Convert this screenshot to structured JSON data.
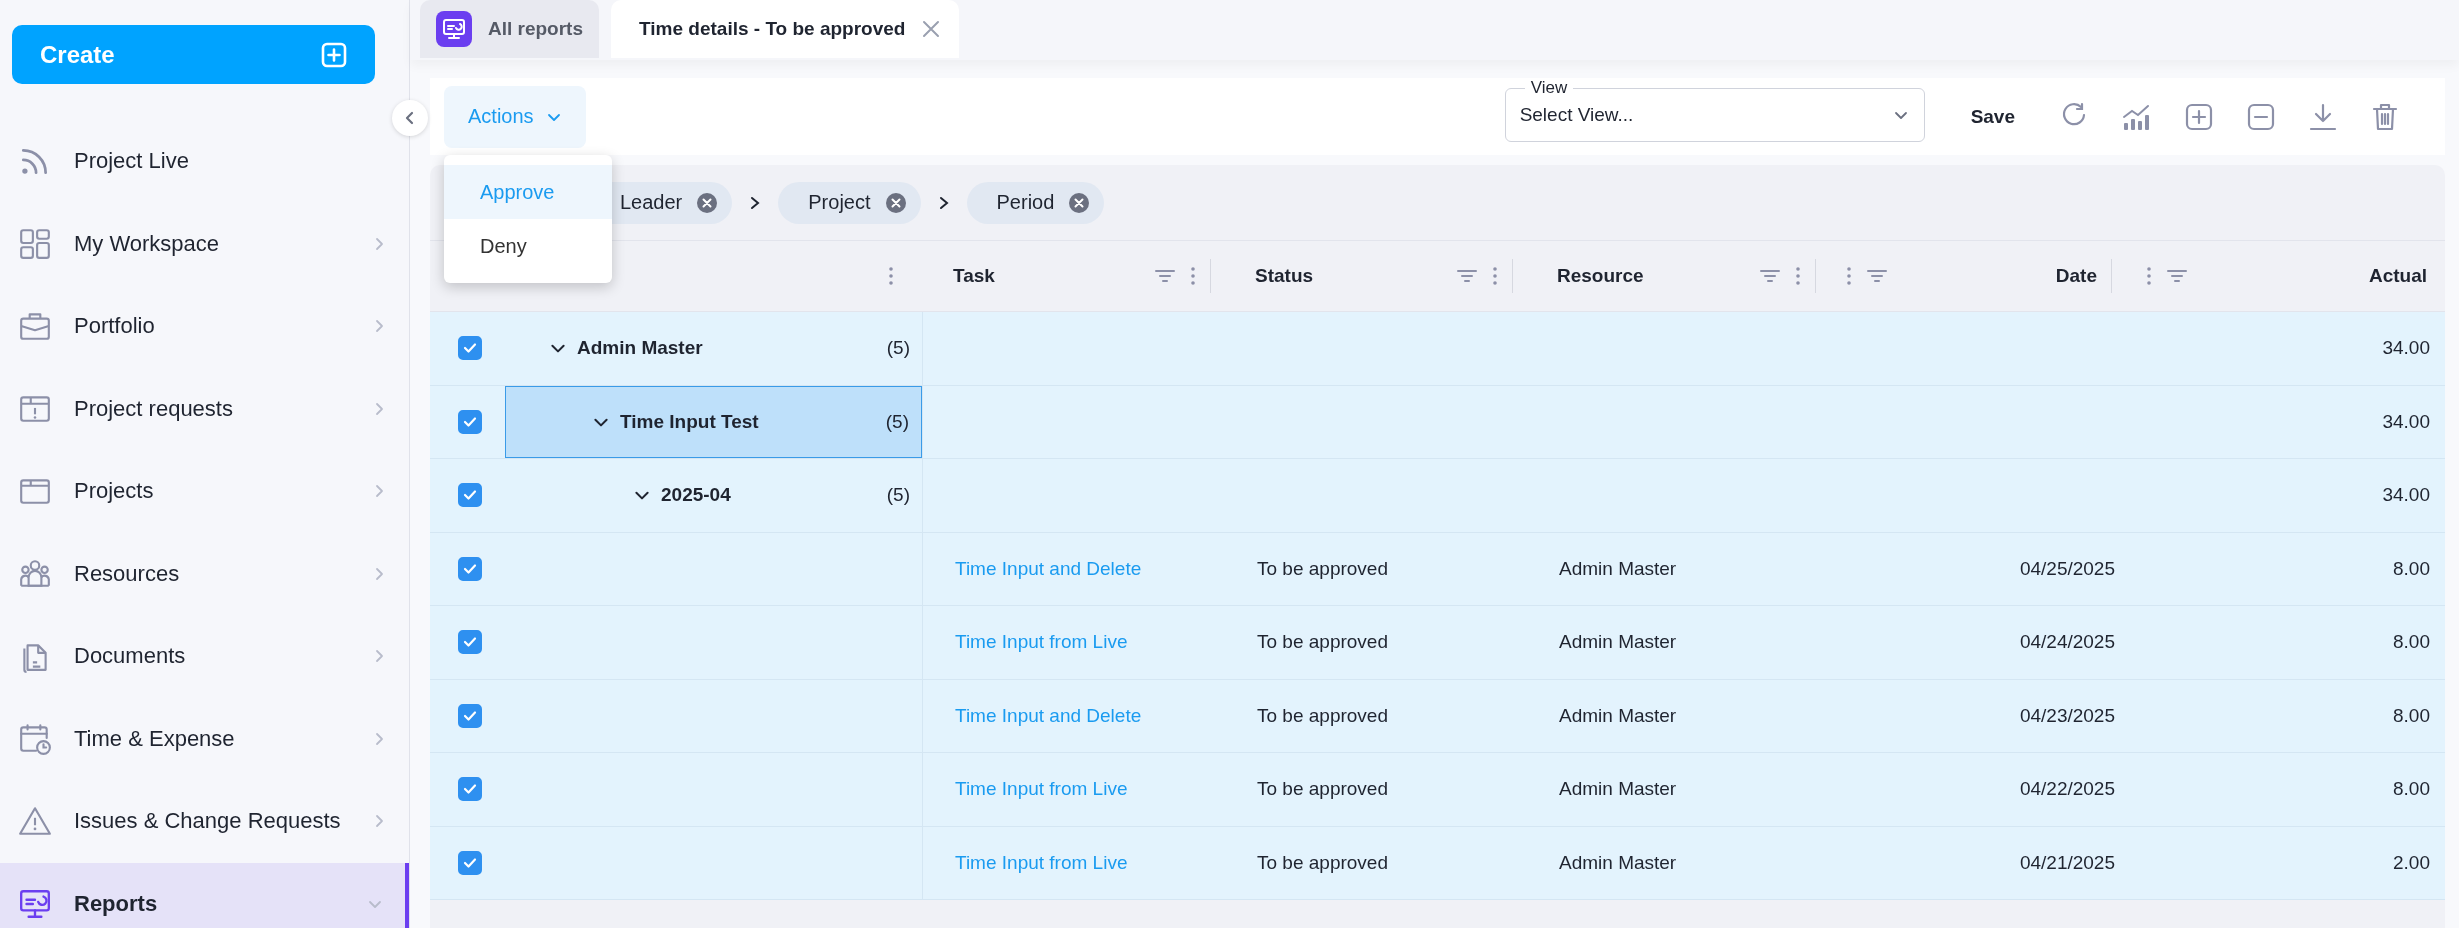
{
  "sidebar": {
    "create_button": "Create",
    "items": [
      {
        "label": "Project Live",
        "kind": "link",
        "selected": false
      },
      {
        "label": "My Workspace",
        "kind": "menu",
        "expanded": false,
        "selected": false
      },
      {
        "label": "Portfolio",
        "kind": "menu",
        "expanded": false,
        "selected": false
      },
      {
        "label": "Project requests",
        "kind": "menu",
        "expanded": false,
        "selected": false
      },
      {
        "label": "Projects",
        "kind": "menu",
        "expanded": false,
        "selected": false
      },
      {
        "label": "Resources",
        "kind": "menu",
        "expanded": false,
        "selected": false
      },
      {
        "label": "Documents",
        "kind": "menu",
        "expanded": false,
        "selected": false
      },
      {
        "label": "Time & Expense",
        "kind": "menu",
        "expanded": false,
        "selected": false
      },
      {
        "label": "Issues & Change Requests",
        "kind": "menu",
        "expanded": false,
        "selected": false
      },
      {
        "label": "Reports",
        "kind": "menu",
        "expanded": true,
        "selected": true
      }
    ]
  },
  "tabs": [
    {
      "label": "All reports",
      "selected": false,
      "closable": false
    },
    {
      "label": "Time details - To be approved",
      "selected": true,
      "closable": true
    }
  ],
  "toolbar": {
    "actions_button": "Actions",
    "actions_menu": [
      {
        "label": "Approve",
        "selected": true
      },
      {
        "label": "Deny",
        "selected": false
      }
    ],
    "view_field": {
      "label": "View",
      "placeholder": "Select View..."
    },
    "save_button": "Save"
  },
  "group_chips": [
    "Leader",
    "Project",
    "Period"
  ],
  "table": {
    "columns": [
      {
        "label": "Task",
        "kind": "left"
      },
      {
        "label": "Status",
        "kind": "left"
      },
      {
        "label": "Resource",
        "kind": "left"
      },
      {
        "label": "Date",
        "kind": "right"
      },
      {
        "label": "Actual",
        "kind": "right"
      }
    ],
    "rows": [
      {
        "label": "Admin Master",
        "count": "(5)",
        "checked": true,
        "expanded": true,
        "focused": false,
        "actual": "34.00",
        "children": [
          {
            "label": "Time Input Test",
            "count": "(5)",
            "checked": true,
            "expanded": true,
            "focused": true,
            "actual": "34.00",
            "children": [
              {
                "label": "2025-04",
                "count": "(5)",
                "checked": true,
                "expanded": true,
                "focused": false,
                "actual": "34.00",
                "children": [
                  {
                    "checked": true,
                    "task": "Time Input and Delete",
                    "status": "To be approved",
                    "resource": "Admin Master",
                    "date": "04/25/2025",
                    "actual": "8.00"
                  },
                  {
                    "checked": true,
                    "task": "Time Input from Live",
                    "status": "To be approved",
                    "resource": "Admin Master",
                    "date": "04/24/2025",
                    "actual": "8.00"
                  },
                  {
                    "checked": true,
                    "task": "Time Input and Delete",
                    "status": "To be approved",
                    "resource": "Admin Master",
                    "date": "04/23/2025",
                    "actual": "8.00"
                  },
                  {
                    "checked": true,
                    "task": "Time Input from Live",
                    "status": "To be approved",
                    "resource": "Admin Master",
                    "date": "04/22/2025",
                    "actual": "8.00"
                  },
                  {
                    "checked": true,
                    "task": "Time Input from Live",
                    "status": "To be approved",
                    "resource": "Admin Master",
                    "date": "04/21/2025",
                    "actual": "2.00"
                  }
                ]
              }
            ]
          }
        ]
      }
    ]
  }
}
